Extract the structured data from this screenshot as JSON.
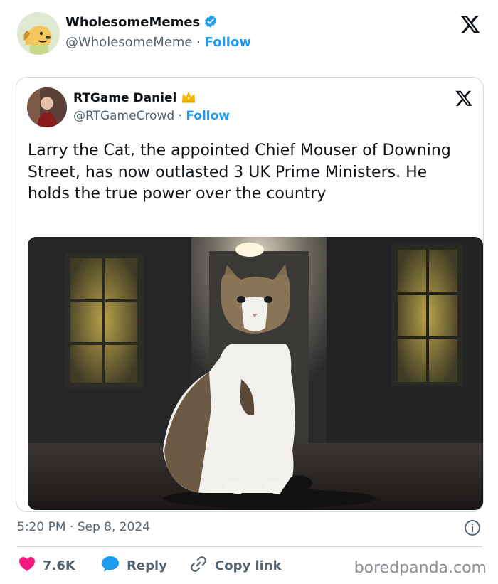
{
  "post": {
    "author_name": "WholesomeMemes",
    "author_handle": "@WholesomeMeme",
    "separator": " · ",
    "follow_label": "Follow",
    "timestamp": "5:20 PM · Sep 8, 2024"
  },
  "quote": {
    "author_name": "RTGame Daniel",
    "author_handle": "@RTGameCrowd",
    "separator": " · ",
    "follow_label": "Follow",
    "text": "Larry the Cat, the appointed Chief Mouser of Downing Street, has now outlasted 3 UK Prime Ministers. He holds the true power over the country"
  },
  "actions": {
    "like_count": "7.6K",
    "reply_label": "Reply",
    "copy_label": "Copy link"
  },
  "watermark": "boredpanda.com",
  "colors": {
    "accent": "#1d9bf0",
    "like": "#f91880",
    "muted": "#536471"
  },
  "icons": [
    "verified-badge-icon",
    "x-logo-icon",
    "crown-icon",
    "info-icon",
    "heart-icon",
    "reply-bubble-icon",
    "link-icon"
  ]
}
